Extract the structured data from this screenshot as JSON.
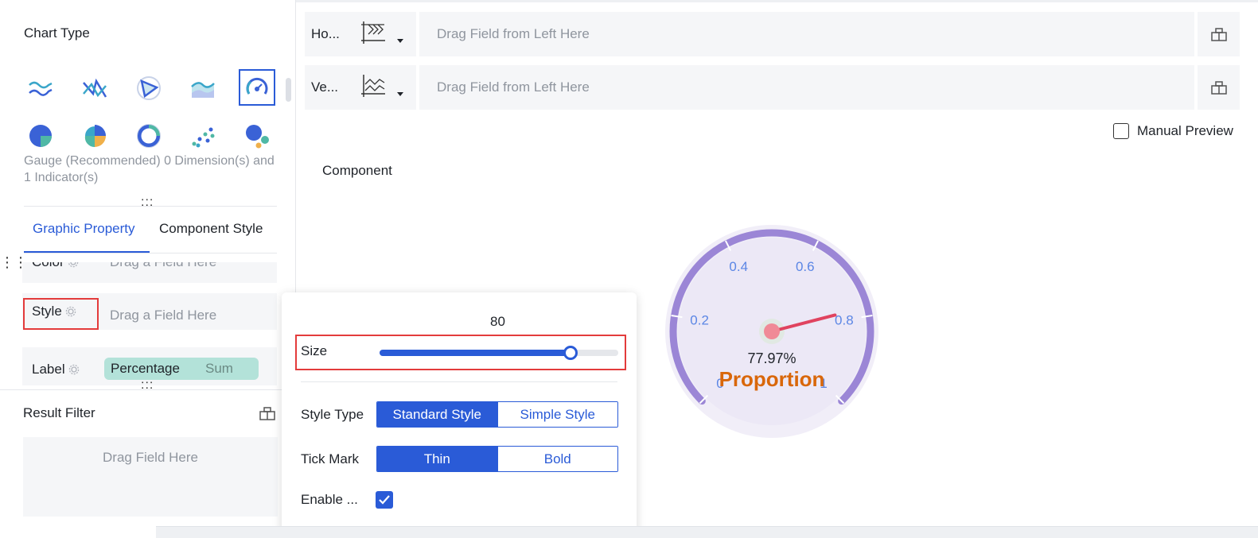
{
  "left_panel": {
    "chart_type_title": "Chart Type",
    "chart_icons": [
      "wave-line-chart-icon",
      "crossed-line-chart-icon",
      "radar-chart-icon",
      "area-chart-icon",
      "gauge-chart-icon",
      "pie-chart-icon",
      "rose-pie-chart-icon",
      "donut-chart-icon",
      "scatter-chart-icon",
      "bubble-chart-icon"
    ],
    "selected_chart": "gauge-chart-icon",
    "chart_description": "Gauge (Recommended) 0 Dimension(s) and 1 Indicator(s)",
    "handle_dots": ":::",
    "tabs": [
      {
        "label": "Graphic Property",
        "active": true
      },
      {
        "label": "Component Style",
        "active": false
      }
    ],
    "fields": {
      "color": {
        "label": "Color",
        "placeholder": "Drag a Field Here"
      },
      "style": {
        "label": "Style",
        "placeholder": "Drag a Field Here"
      },
      "label": {
        "label": "Label",
        "pill_primary": "Percentage",
        "pill_secondary": "Sum"
      }
    },
    "result_filter": {
      "title": "Result Filter",
      "placeholder": "Drag Field Here"
    }
  },
  "axes": {
    "horizontal": {
      "label": "Ho...",
      "placeholder": "Drag Field from Left Here"
    },
    "vertical": {
      "label": "Ve...",
      "placeholder": "Drag Field from Left Here"
    }
  },
  "manual_preview": {
    "label": "Manual Preview",
    "checked": false
  },
  "component_label": "Component",
  "popup": {
    "size_value": "80",
    "size_label": "Size",
    "size_fraction": 0.8,
    "style_type": {
      "label": "Style Type",
      "options": [
        "Standard Style",
        "Simple Style"
      ],
      "selected": "Standard Style"
    },
    "tick_mark": {
      "label": "Tick Mark",
      "options": [
        "Thin",
        "Bold"
      ],
      "selected": "Thin"
    },
    "enable": {
      "label": "Enable ...",
      "checked": true
    }
  },
  "gauge": {
    "tick_labels": [
      "0",
      "0.2",
      "0.4",
      "0.6",
      "0.8",
      "1"
    ],
    "value_label": "77.97%",
    "value": 0.7797,
    "caption": "Proportion",
    "colors": {
      "ring": "#9b86d6",
      "face": "#ece8f6",
      "tick_text": "#5b86e5",
      "needle": "#e0435f",
      "caption": "#d9670a"
    }
  },
  "colors": {
    "accent": "#2a5bd7",
    "highlight": "#e33b3b",
    "pill": "#b3e2d9"
  }
}
